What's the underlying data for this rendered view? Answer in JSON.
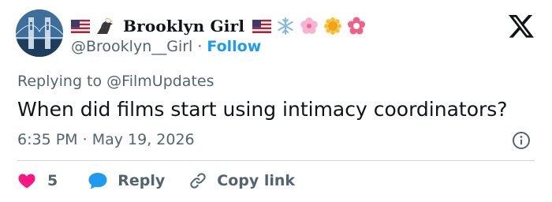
{
  "author": {
    "display_name": "Brooklyn Girl",
    "handle": "@Brooklyn__Girl",
    "separator": "·",
    "follow_label": "Follow",
    "name_prefix_icons": [
      "us-flag-icon",
      "eagle-icon"
    ],
    "name_suffix_icons": [
      "us-flag-icon",
      "snowflake-icon",
      "cherry-blossom-icon",
      "sun-icon",
      "flower-icon"
    ]
  },
  "replying": {
    "prefix": "Replying to",
    "mention": "@FilmUpdates"
  },
  "tweet": {
    "text": "When did films start using intimacy coordinators?",
    "time": "6:35 PM",
    "separator": "·",
    "date": "May 19, 2026"
  },
  "actions": {
    "like_count": "5",
    "reply_label": "Reply",
    "copy_label": "Copy link"
  },
  "colors": {
    "text": "#0f1419",
    "secondary": "#536471",
    "accent": "#1d9bf0",
    "like": "#f91880",
    "divider": "#cfd9de"
  }
}
